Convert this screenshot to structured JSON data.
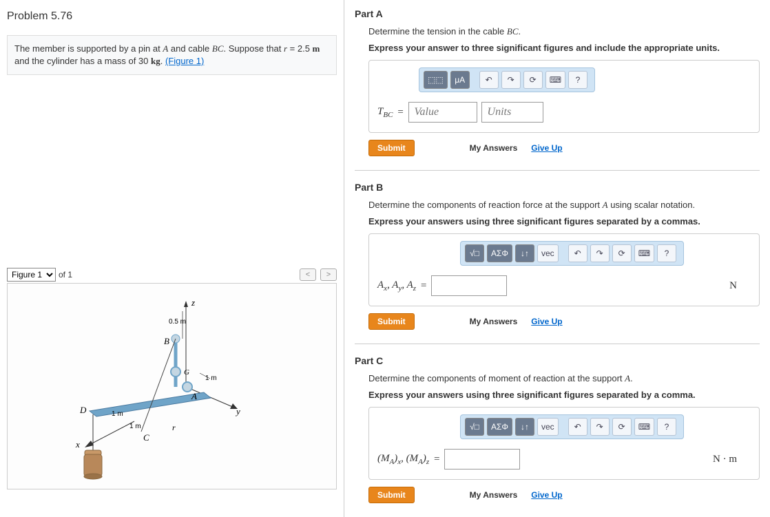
{
  "problem": {
    "title": "Problem 5.76",
    "description_prefix": "The member is supported by a pin at ",
    "varA": "A",
    "description_mid1": " and cable ",
    "varBC": "BC",
    "description_mid2": ". Suppose that ",
    "varR": "r",
    "description_mid3": " = 2.5 ",
    "unit_m": "m",
    "description_mid4": " and the cylinder has a mass of 30 ",
    "unit_kg": "kg",
    "description_end": ". ",
    "figure_link": "(Figure 1)"
  },
  "figure": {
    "selector_option": "Figure 1",
    "of_text": "of 1",
    "labels": {
      "z": "z",
      "x": "x",
      "y": "y",
      "A": "A",
      "B": "B",
      "C": "C",
      "D": "D",
      "G": "G",
      "dim05": "0.5 m",
      "dim1a": "1 m",
      "dim1b": "1 m",
      "dim1c": "1 m",
      "r": "r"
    }
  },
  "toolbar": {
    "templates": "⬚⬚",
    "units": "μA",
    "sqrt": "√□",
    "greek": "ΑΣΦ",
    "updown": "↓↑",
    "vec": "vec",
    "undo": "↶",
    "redo": "↷",
    "reset": "⟳",
    "keyboard": "⌨",
    "help": "?"
  },
  "partA": {
    "label": "Part A",
    "prompt": "Determine the tension in the cable BC.",
    "hint": "Express your answer to three significant figures and include the appropriate units.",
    "eq_label": "T",
    "eq_sub": "BC",
    "eq": " = ",
    "value_ph": "Value",
    "units_ph": "Units",
    "submit": "Submit",
    "myans": "My Answers",
    "giveup": "Give Up"
  },
  "partB": {
    "label": "Part B",
    "prompt": "Determine the components of reaction force at the support A using scalar notation.",
    "hint": "Express your answers using three significant figures separated by a commas.",
    "eq_html": "A_x, A_y, A_z",
    "eq": " = ",
    "unit": "N",
    "submit": "Submit",
    "myans": "My Answers",
    "giveup": "Give Up"
  },
  "partC": {
    "label": "Part C",
    "prompt": "Determine the components of moment of reaction at the support A.",
    "hint": "Express your answers using three significant figures separated by a comma.",
    "eq_html": "(M_A)_x, (M_A)_z",
    "eq": " = ",
    "unit": "N · m",
    "submit": "Submit",
    "myans": "My Answers",
    "giveup": "Give Up"
  }
}
